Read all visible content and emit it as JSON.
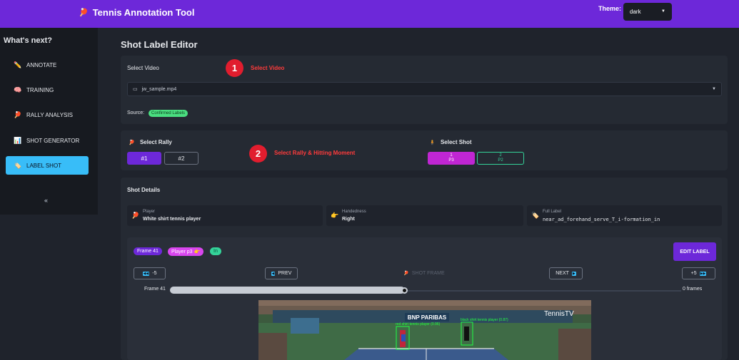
{
  "header": {
    "app_title": "Tennis Annotation Tool",
    "app_icon": "racket-icon",
    "theme_label": "Theme:",
    "theme_value": "dark"
  },
  "sidebar": {
    "title": "What's next?",
    "items": [
      {
        "label": "ANNOTATE",
        "icon": "pencil-icon"
      },
      {
        "label": "TRAINING",
        "icon": "brain-icon"
      },
      {
        "label": "RALLY ANALYSIS",
        "icon": "racket-icon"
      },
      {
        "label": "SHOT GENERATOR",
        "icon": "chart-icon"
      },
      {
        "label": "LABEL SHOT",
        "icon": "tag-icon"
      }
    ],
    "active_index": 4,
    "collapse": "«"
  },
  "page": {
    "title": "Shot Label Editor"
  },
  "video_card": {
    "label": "Select Video",
    "step_number": "1",
    "step_text": "Select Video",
    "selected_video": "jw_sample.mp4",
    "source_label": "Source:",
    "source_badge": "Confirmed Labels"
  },
  "rally_card": {
    "rally_label": "Select Rally",
    "rallies": [
      "#1",
      "#2"
    ],
    "selected_rally": "#1",
    "step_number": "2",
    "step_text": "Select Rally & Hitting Moment",
    "shot_label": "Select Shot",
    "shots": [
      {
        "num": "1",
        "player": "P3"
      },
      {
        "num": "2",
        "player": "P2"
      }
    ]
  },
  "details_card": {
    "title": "Shot Details",
    "player_key": "Player",
    "player_value": "White shirt tennis player",
    "handedness_key": "Handedness",
    "handedness_value": "Right",
    "full_label_key": "Full Label",
    "full_label_value": "near_ad_forehand_serve_T_i-formation_in"
  },
  "frame_panel": {
    "frame_pill": "Frame 41",
    "player_pill": "Player p3 👉",
    "in_pill": "In",
    "edit_label": "EDIT LABEL",
    "back5": "-5",
    "prev": "PREV",
    "shot_frame": "SHOT FRAME",
    "next": "NEXT",
    "fwd5": "+5",
    "slider_left": "Frame 41",
    "slider_right": "0 frames",
    "slider_fraction": 0.46
  },
  "video_frame": {
    "banner": "BNP PARIBAS",
    "broadcaster": "TennisTV",
    "det_left": "red shirt tennis player (0.96)",
    "det_right": "black shirt tennis player (0.87)"
  },
  "colors": {
    "accent": "#6d28d9",
    "active_nav": "#38bdf8",
    "step": "#e11d2e"
  }
}
